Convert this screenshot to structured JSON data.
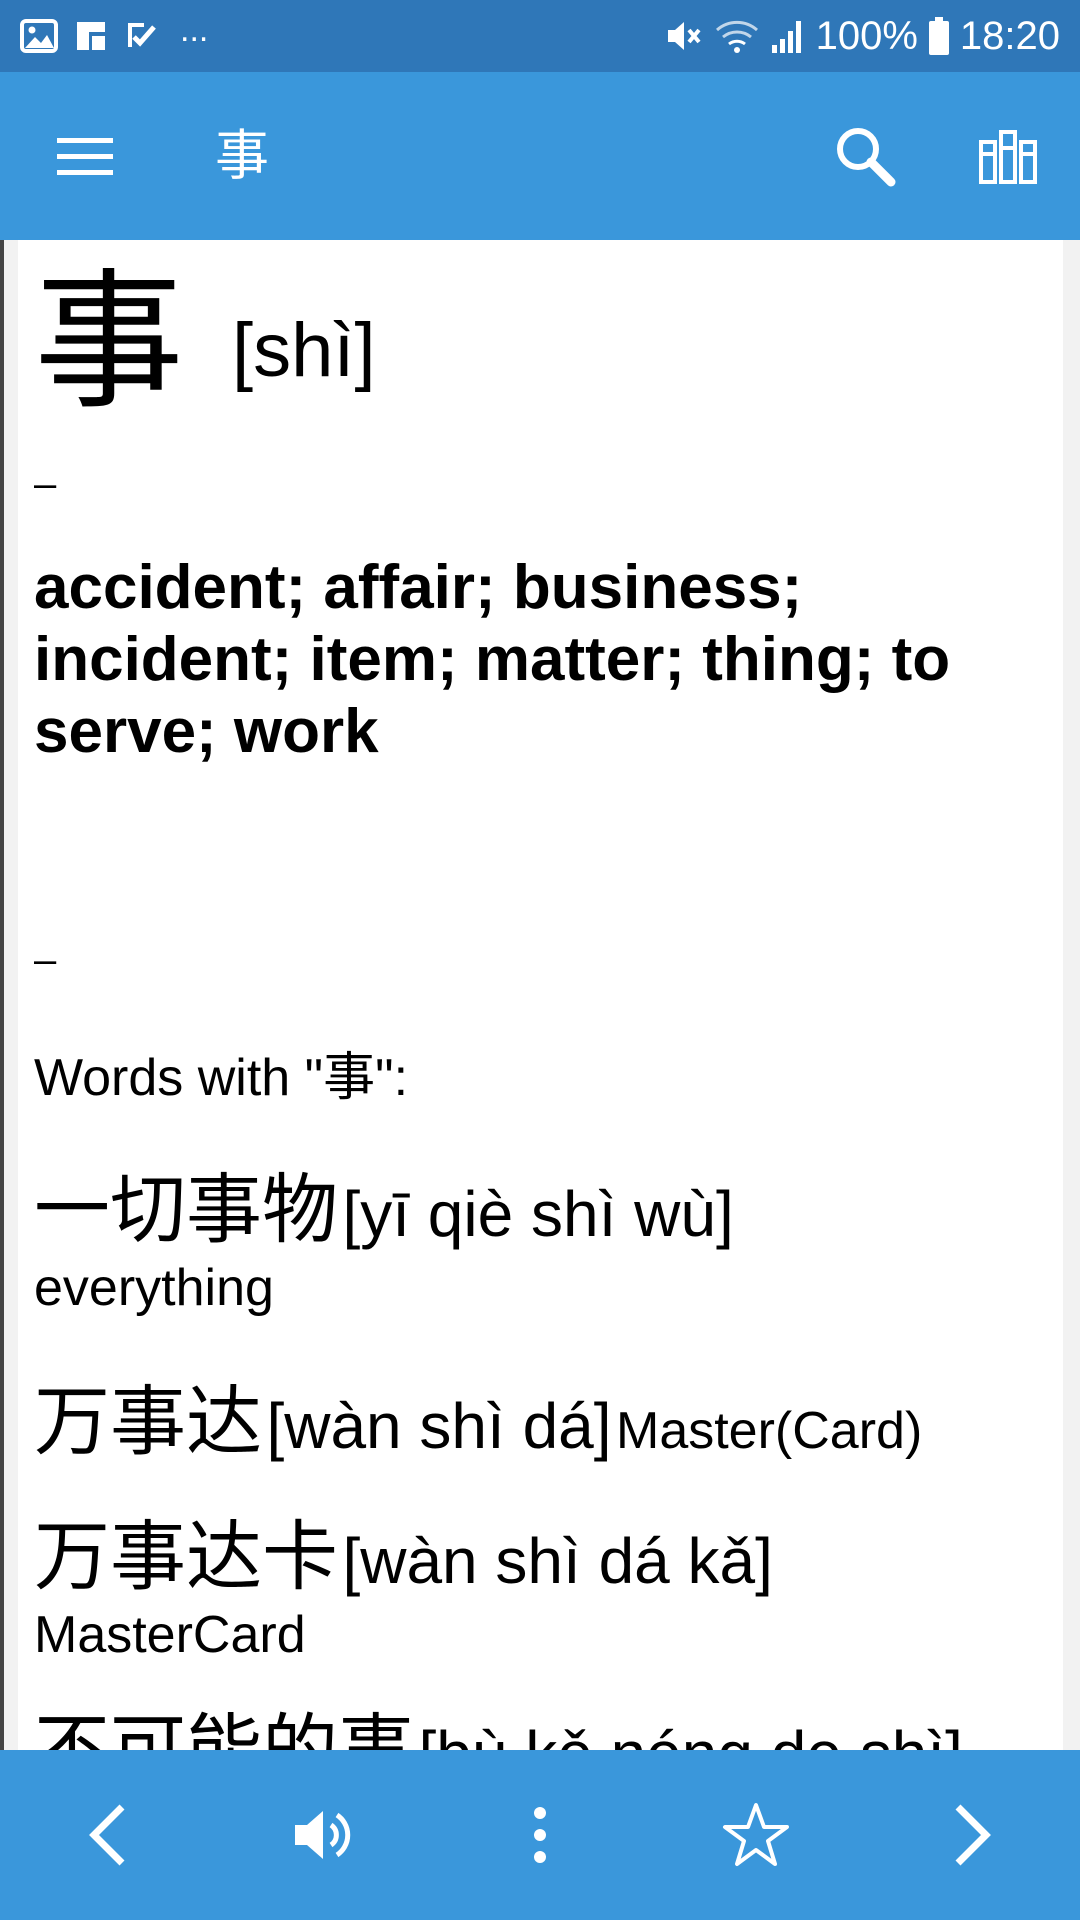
{
  "status_bar": {
    "more_indicator": "...",
    "battery": "100%",
    "time": "18:20"
  },
  "app_bar": {
    "title": "事",
    "icons": [
      "menu-icon",
      "search-icon",
      "books-icon"
    ]
  },
  "entry": {
    "headword": "事",
    "pinyin": "[shì]",
    "separator": "–",
    "definition": "accident; affair; business; incident; item; matter; thing; to serve; work",
    "words_heading": "Words with \"事\":",
    "words": [
      {
        "hanzi": "一切事物",
        "pinyin": "[yī qiè shì wù]",
        "meaning": "everything"
      },
      {
        "hanzi": "万事达",
        "pinyin": "[wàn shì dá]",
        "meaning": "Master(Card)"
      },
      {
        "hanzi": "万事达卡",
        "pinyin": "[wàn shì dá kǎ]",
        "meaning": "MasterCard"
      },
      {
        "hanzi": "不可能的事",
        "pinyin": "[bù kě néng de shì]"
      }
    ]
  },
  "bottom_bar": {
    "icons": [
      "back-arrow-icon",
      "speaker-icon",
      "more-vert-icon",
      "star-icon",
      "forward-arrow-icon"
    ]
  },
  "colors": {
    "status_bar": "#2f77b8",
    "app_bar": "#3a97db",
    "content_bg": "#ffffff"
  }
}
